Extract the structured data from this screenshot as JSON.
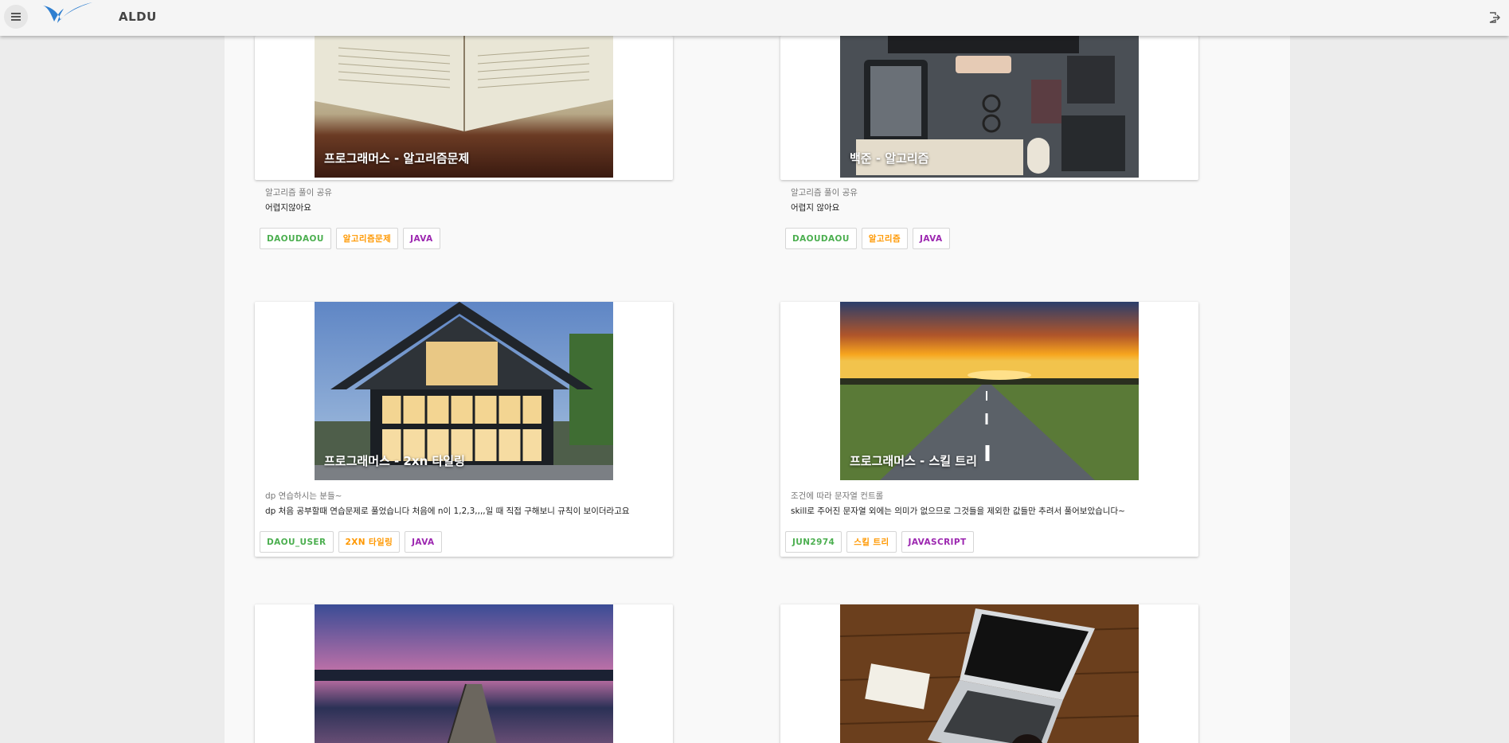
{
  "header": {
    "title": "ALDU",
    "brand_color": "#2f7fd0"
  },
  "icons": {
    "menu": "menu-icon",
    "logo": "aldu-logo-icon",
    "logout": "logout-icon"
  },
  "colors": {
    "author": "#4caf50",
    "topic": "#ff9800",
    "language": "#9c27b0"
  },
  "cards": [
    {
      "image_title": "프로그래머스 - 알고리즘문제",
      "category": "알고리즘 풀이 공유",
      "description": "어렵지않아요",
      "author": "DAOUDAOU",
      "topic": "알고리즘문제",
      "language": "JAVA"
    },
    {
      "image_title": "백준 - 알고리즘",
      "category": "알고리즘 풀이 공유",
      "description": "어렵지 않아요",
      "author": "DAOUDAOU",
      "topic": "알고리즘",
      "language": "JAVA"
    },
    {
      "image_title": "프로그래머스 - 2xn 타일링",
      "category": "dp 연습하시는 분들~",
      "description": "dp 처음 공부할때 연습문제로 풀었습니다 처음에 n이 1,2,3,,,,일 때 직접 구해보니 규칙이 보이더라고요",
      "author": "DAOU_USER",
      "topic": "2XN 타일링",
      "language": "JAVA"
    },
    {
      "image_title": "프로그래머스 - 스킬 트리",
      "category": "조건에 따라 문자열 컨트롤",
      "description": "skill로 주어진 문자열 외에는 의미가 없으므로 그것들을 제외한 값들만 추려서 풀어보았습니다~",
      "author": "JUN2974",
      "topic": "스킬 트리",
      "language": "JAVASCRIPT"
    }
  ]
}
